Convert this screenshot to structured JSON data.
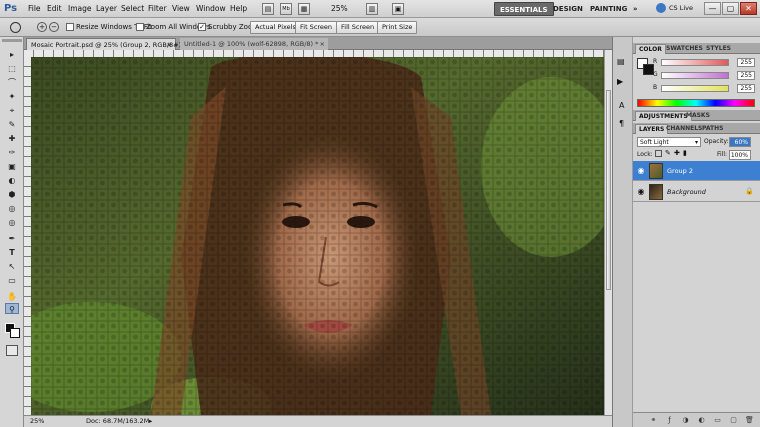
{
  "app": {
    "logo": "Ps",
    "menus": [
      "File",
      "Edit",
      "Image",
      "Layer",
      "Select",
      "Filter",
      "View",
      "Window",
      "Help"
    ],
    "zoom_menu": "25%",
    "workspaces": {
      "active": "ESSENTIALS",
      "items": [
        "DESIGN",
        "PAINTING"
      ],
      "more": "»"
    },
    "cs_live": "CS Live",
    "window_buttons": [
      "—",
      "▢",
      "✕"
    ]
  },
  "options_bar": {
    "resize_windows_label": "Resize Windows To Fit",
    "zoom_all_label": "Zoom All Windows",
    "scrubby_zoom_label": "Scrubby Zoom",
    "actual_pixels": "Actual Pixels",
    "fit_screen": "Fit Screen",
    "fill_screen": "Fill Screen",
    "print_size": "Print Size"
  },
  "documents": {
    "tabs": [
      {
        "label": "Mosaic Portrait.psd @ 25% (Group 2, RGB/8#) *",
        "close": "×"
      },
      {
        "label": "Untitled-1 @ 100% (wolf-62898, RGB/8) *",
        "close": "×"
      }
    ]
  },
  "status": {
    "zoom": "25%",
    "doc": "Doc: 68.7M/163.2M"
  },
  "color_panel": {
    "tabs": [
      "COLOR",
      "SWATCHES",
      "STYLES"
    ],
    "channels": [
      {
        "name": "R",
        "value": "255",
        "color": "#e05a5a"
      },
      {
        "name": "G",
        "value": "255",
        "color": "#c070d0"
      },
      {
        "name": "B",
        "value": "255",
        "color": "#e2e25a"
      }
    ]
  },
  "adjustments_panel": {
    "tabs": [
      "ADJUSTMENTS",
      "MASKS"
    ]
  },
  "layers_panel": {
    "tabs": [
      "LAYERS",
      "CHANNELS",
      "PATHS"
    ],
    "blend_mode": "Soft Light",
    "opacity_label": "Opacity:",
    "opacity": "60%",
    "lock_label": "Lock:",
    "fill_label": "Fill:",
    "fill": "100%",
    "layers": [
      {
        "name": "Group 2",
        "selected": true
      },
      {
        "name": "Background",
        "selected": false
      }
    ]
  },
  "tools": [
    "▸",
    "⬚",
    "⌒",
    "✦",
    "⌖",
    "✎",
    "✚",
    "✑",
    "▣",
    "◐",
    "⬢",
    "◎",
    "✒",
    "T",
    "↖",
    "▭",
    "✋",
    "⚲"
  ]
}
